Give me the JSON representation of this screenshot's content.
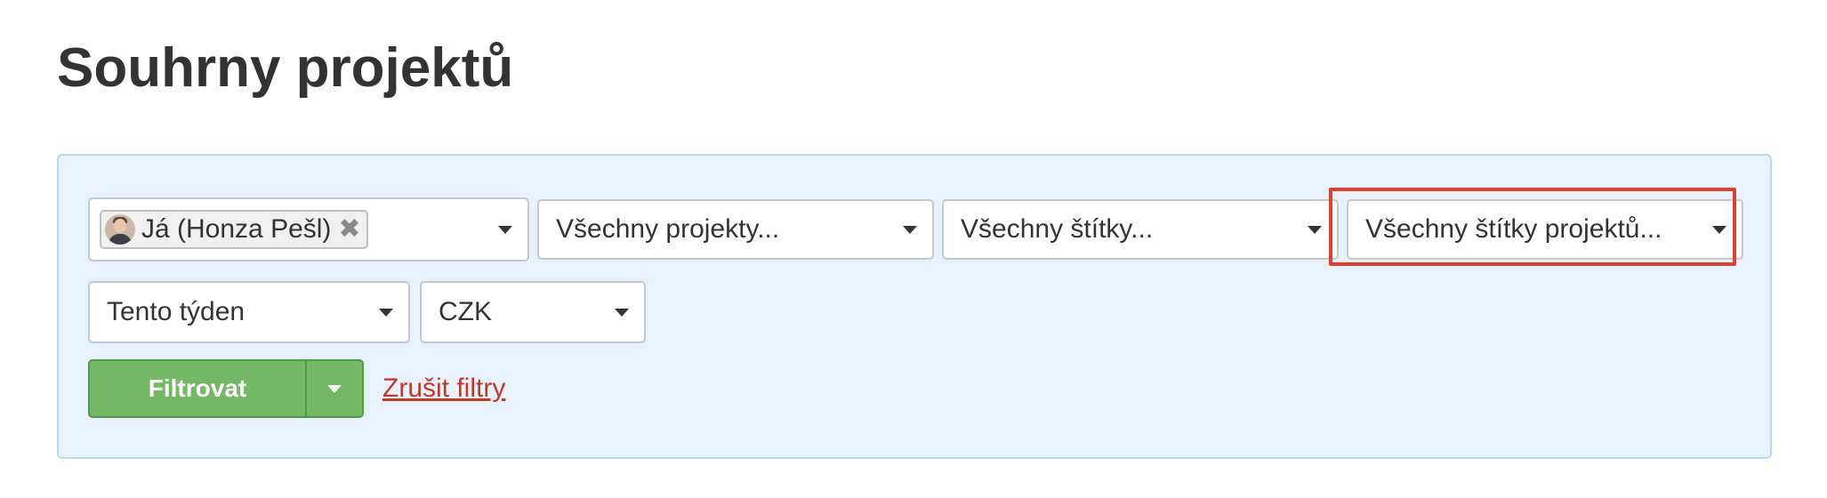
{
  "page": {
    "title": "Souhrny projektů"
  },
  "filters": {
    "user": {
      "chip_label": "Já (Honza Pešl)",
      "remove_glyph": "✖"
    },
    "projects": {
      "value": "Všechny projekty..."
    },
    "tags": {
      "value": "Všechny štítky..."
    },
    "project_tags": {
      "value": "Všechny štítky projektů..."
    },
    "period": {
      "value": "Tento týden"
    },
    "currency": {
      "value": "CZK"
    }
  },
  "actions": {
    "filter_label": "Filtrovat",
    "reset_label": "Zrušit filtry"
  },
  "colors": {
    "panel_bg": "#e8f2fc",
    "panel_border": "#bcd8f0",
    "primary_button": "#74b866",
    "link": "#c0392b",
    "highlight": "#e04030"
  },
  "icons": {
    "dropdown": "caret-down-icon",
    "remove": "close-icon",
    "avatar": "user-avatar"
  }
}
